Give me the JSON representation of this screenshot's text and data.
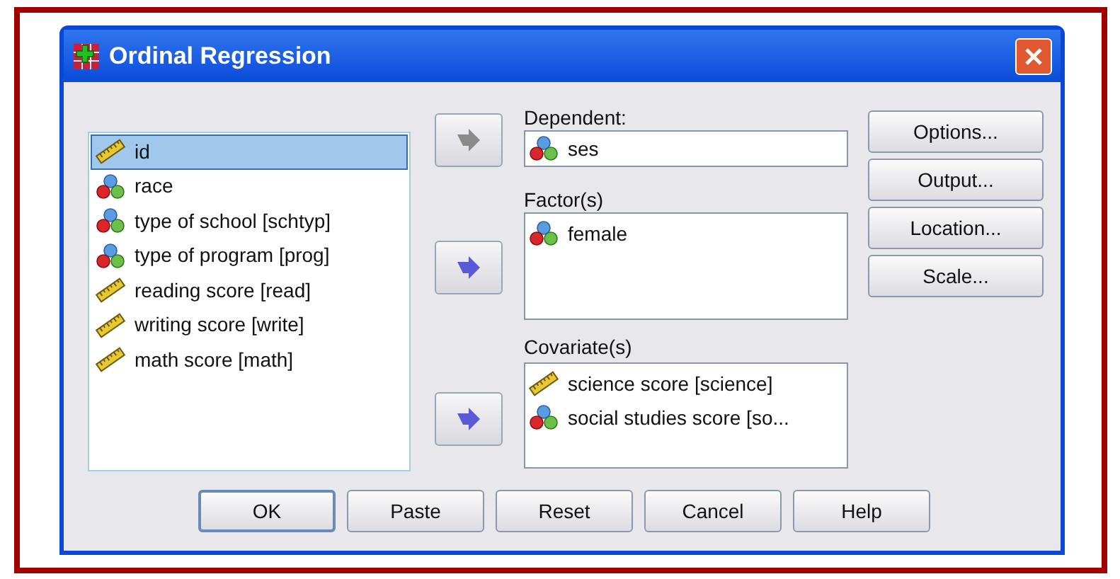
{
  "window": {
    "title": "Ordinal Regression"
  },
  "variables": [
    {
      "label": "id",
      "kind": "scale",
      "selected": true
    },
    {
      "label": "race",
      "kind": "nominal",
      "selected": false
    },
    {
      "label": "type of school [schtyp]",
      "kind": "nominal",
      "selected": false
    },
    {
      "label": "type of program [prog]",
      "kind": "nominal",
      "selected": false
    },
    {
      "label": "reading score [read]",
      "kind": "scale",
      "selected": false
    },
    {
      "label": "writing score [write]",
      "kind": "scale",
      "selected": false
    },
    {
      "label": "math score [math]",
      "kind": "scale",
      "selected": false
    }
  ],
  "targets": [
    {
      "label": "Dependent:",
      "kind": "field",
      "arrow_disabled": true,
      "items": [
        {
          "label": "ses",
          "kind": "nominal"
        }
      ]
    },
    {
      "label": "Factor(s)",
      "kind": "list",
      "arrow_disabled": false,
      "items": [
        {
          "label": "female",
          "kind": "nominal"
        }
      ]
    },
    {
      "label": "Covariate(s)",
      "kind": "list",
      "arrow_disabled": false,
      "items": [
        {
          "label": "science score [science]",
          "kind": "scale"
        },
        {
          "label": "social studies score [so...",
          "kind": "nominal"
        }
      ]
    }
  ],
  "side_buttons": [
    "Options...",
    "Output...",
    "Location...",
    "Scale..."
  ],
  "buttons": [
    {
      "label": "OK",
      "default": true
    },
    {
      "label": "Paste",
      "default": false
    },
    {
      "label": "Reset",
      "default": false
    },
    {
      "label": "Cancel",
      "default": false
    },
    {
      "label": "Help",
      "default": false
    }
  ]
}
